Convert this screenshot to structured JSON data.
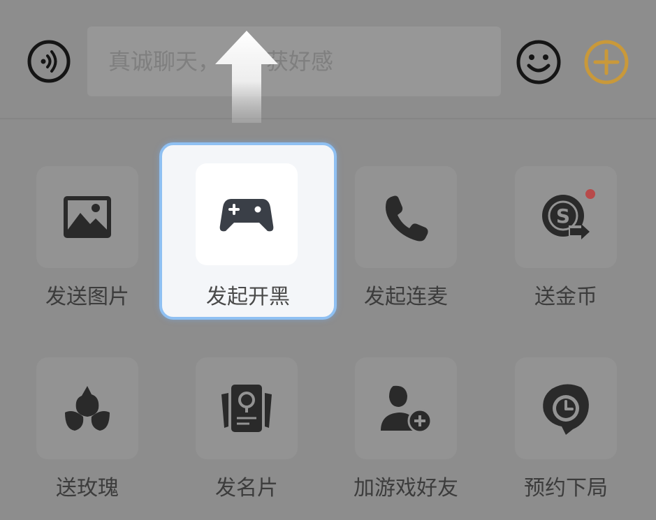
{
  "input_bar": {
    "placeholder": "真诚聊天，",
    "placeholder_tail": "获好感",
    "voice_icon": "voice-icon",
    "emoji_icon": "emoji-icon",
    "plus_icon": "plus-icon",
    "accent_color": "#c9993a"
  },
  "guide": {
    "icon": "arrow-up-icon"
  },
  "panel": {
    "row1": [
      {
        "label": "发送图片",
        "icon": "image-icon"
      },
      {
        "label": "发起开黑",
        "icon": "gamepad-icon",
        "highlighted": true
      },
      {
        "label": "发起连麦",
        "icon": "phone-icon"
      },
      {
        "label": "送金币",
        "icon": "coin-send-icon",
        "badge": true
      }
    ],
    "row2": [
      {
        "label": "送玫瑰",
        "icon": "rose-icon"
      },
      {
        "label": "发名片",
        "icon": "card-icon"
      },
      {
        "label": "加游戏好友",
        "icon": "add-friend-icon"
      },
      {
        "label": "预约下局",
        "icon": "schedule-icon"
      }
    ],
    "highlight_color": "#8fc0f2",
    "badge_color": "#b84a4a"
  }
}
